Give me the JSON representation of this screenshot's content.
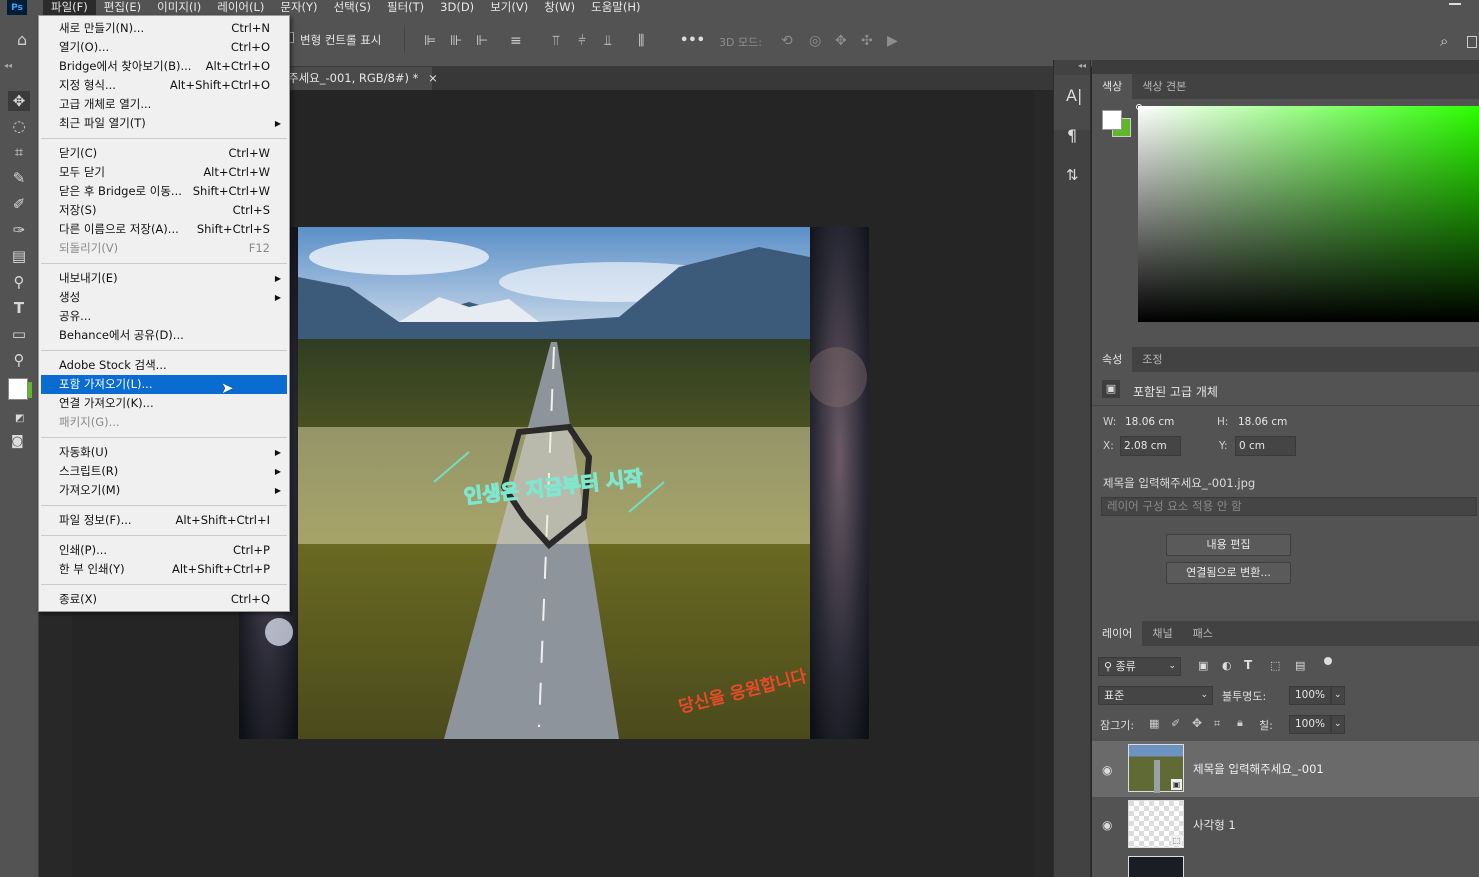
{
  "app": {
    "logo": "Ps"
  },
  "menubar": {
    "items": [
      {
        "label": "파일(F)"
      },
      {
        "label": "편집(E)"
      },
      {
        "label": "이미지(I)"
      },
      {
        "label": "레이어(L)"
      },
      {
        "label": "문자(Y)"
      },
      {
        "label": "선택(S)"
      },
      {
        "label": "필터(T)"
      },
      {
        "label": "3D(D)"
      },
      {
        "label": "보기(V)"
      },
      {
        "label": "창(W)"
      },
      {
        "label": "도움말(H)"
      }
    ]
  },
  "options_bar": {
    "transform_label": "변형 컨트롤 표시",
    "mode_label": "3D 모드:",
    "more": "•••"
  },
  "document": {
    "tab_title": "주세요_-001, RGB/8#) *",
    "close": "×"
  },
  "file_menu": {
    "groups": [
      [
        {
          "label": "새로 만들기(N)...",
          "shortcut": "Ctrl+N"
        },
        {
          "label": "열기(O)...",
          "shortcut": "Ctrl+O"
        },
        {
          "label": "Bridge에서 찾아보기(B)...",
          "shortcut": "Alt+Ctrl+O"
        },
        {
          "label": "지정 형식...",
          "shortcut": "Alt+Shift+Ctrl+O"
        },
        {
          "label": "고급 개체로 열기..."
        },
        {
          "label": "최근 파일 열기(T)",
          "submenu": true
        }
      ],
      [
        {
          "label": "닫기(C)",
          "shortcut": "Ctrl+W"
        },
        {
          "label": "모두 닫기",
          "shortcut": "Alt+Ctrl+W"
        },
        {
          "label": "닫은 후 Bridge로 이동...",
          "shortcut": "Shift+Ctrl+W"
        },
        {
          "label": "저장(S)",
          "shortcut": "Ctrl+S"
        },
        {
          "label": "다른 이름으로 저장(A)...",
          "shortcut": "Shift+Ctrl+S"
        },
        {
          "label": "되돌리기(V)",
          "shortcut": "F12",
          "disabled": true
        }
      ],
      [
        {
          "label": "내보내기(E)",
          "submenu": true
        },
        {
          "label": "생성",
          "submenu": true
        },
        {
          "label": "공유..."
        },
        {
          "label": "Behance에서 공유(D)..."
        }
      ],
      [
        {
          "label": "Adobe Stock 검색..."
        },
        {
          "label": "포함 가져오기(L)...",
          "highlighted": true
        },
        {
          "label": "연결 가져오기(K)..."
        },
        {
          "label": "패키지(G)...",
          "disabled": true
        }
      ],
      [
        {
          "label": "자동화(U)",
          "submenu": true
        },
        {
          "label": "스크립트(R)",
          "submenu": true
        },
        {
          "label": "가져오기(M)",
          "submenu": true
        }
      ],
      [
        {
          "label": "파일 정보(F)...",
          "shortcut": "Alt+Shift+Ctrl+I"
        }
      ],
      [
        {
          "label": "인쇄(P)...",
          "shortcut": "Ctrl+P"
        },
        {
          "label": "한 부 인쇄(Y)",
          "shortcut": "Alt+Shift+Ctrl+P"
        }
      ],
      [
        {
          "label": "종료(X)",
          "shortcut": "Ctrl+Q"
        }
      ]
    ]
  },
  "canvas_art": {
    "headline": "인생은 지금부터 시작",
    "corner_text": "당신을 응원합니다"
  },
  "color_panel": {
    "tabs": [
      "색상",
      "색상 견본"
    ],
    "fg_color": "#ffffff",
    "bg_color": "#5fb82a",
    "hue_color": "#2bff00"
  },
  "properties_panel": {
    "tabs": [
      "속성",
      "조정"
    ],
    "type_label": "포함된 고급 개체",
    "w_label": "W:",
    "w_value": "18.06 cm",
    "h_label": "H:",
    "h_value": "18.06 cm",
    "x_label": "X:",
    "x_value": "2.08 cm",
    "y_label": "Y:",
    "y_value": "0 cm",
    "filename": "제목을 입력해주세요_-001.jpg",
    "comp_placeholder": "레이어 구성 요소 적용 안 함",
    "edit_button": "내용 편집",
    "convert_button": "연결됨으로 변환..."
  },
  "layers_panel": {
    "tabs": [
      "레이어",
      "채널",
      "패스"
    ],
    "filter_label": "종류",
    "blend_mode": "표준",
    "opacity_label": "불투명도:",
    "opacity_value": "100%",
    "lock_label": "잠그기:",
    "fill_label": "칠:",
    "fill_value": "100%",
    "layers": [
      {
        "name": "제목을 입력해주세요_-001",
        "selected": true
      },
      {
        "name": "사각형 1",
        "selected": false
      }
    ]
  }
}
